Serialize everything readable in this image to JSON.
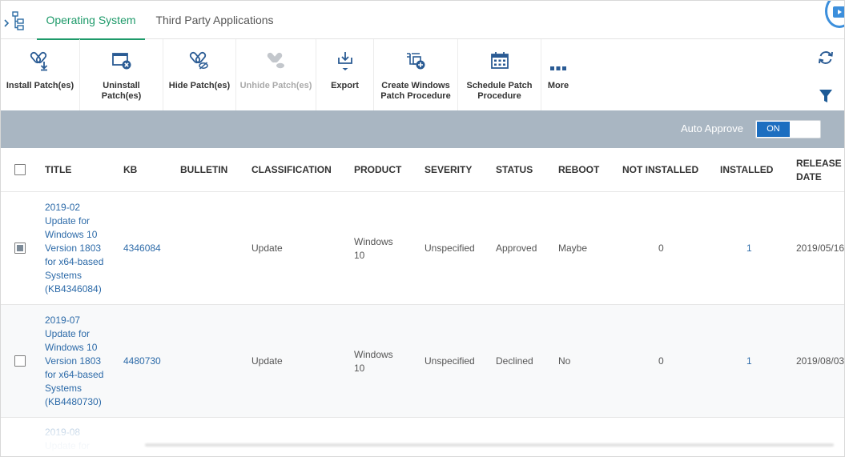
{
  "tabs": [
    {
      "label": "Operating System",
      "active": true
    },
    {
      "label": "Third Party Applications",
      "active": false
    }
  ],
  "toolbar": {
    "install": "Install Patch(es)",
    "uninstall_1": "Uninstall",
    "uninstall_2": "Patch(es)",
    "hide": "Hide Patch(es)",
    "unhide": "Unhide Patch(es)",
    "export": "Export",
    "create_1": "Create Windows",
    "create_2": "Patch Procedure",
    "schedule_1": "Schedule Patch",
    "schedule_2": "Procedure",
    "more": "More"
  },
  "auto_approve": {
    "label": "Auto Approve",
    "state": "ON"
  },
  "table": {
    "headers": {
      "title": "TITLE",
      "kb": "KB",
      "bulletin": "BULLETIN",
      "classification": "CLASSIFICATION",
      "product": "PRODUCT",
      "severity": "SEVERITY",
      "status": "STATUS",
      "reboot": "REBOOT",
      "not_installed": "NOT INSTALLED",
      "installed": "INSTALLED",
      "release_1": "RELEASE",
      "release_2": "DATE"
    },
    "rows": [
      {
        "checked": true,
        "title_lines": [
          "2019-02",
          "Update for",
          "Windows 10",
          "Version 1803",
          "for x64-based",
          "Systems",
          "(KB4346084)"
        ],
        "kb": "4346084",
        "bulletin": "",
        "classification": "Update",
        "product_1": "Windows",
        "product_2": "10",
        "severity": "Unspecified",
        "status": "Approved",
        "reboot": "Maybe",
        "not_installed": "0",
        "installed": "1",
        "release_date": "2019/05/16"
      },
      {
        "checked": false,
        "title_lines": [
          "2019-07",
          "Update for",
          "Windows 10",
          "Version 1803",
          "for x64-based",
          "Systems",
          "(KB4480730)"
        ],
        "kb": "4480730",
        "bulletin": "",
        "classification": "Update",
        "product_1": "Windows",
        "product_2": "10",
        "severity": "Unspecified",
        "status": "Declined",
        "reboot": "No",
        "not_installed": "0",
        "installed": "1",
        "release_date": "2019/08/03"
      },
      {
        "checked": false,
        "title_lines": [
          "2019-08",
          "Update for"
        ]
      }
    ]
  },
  "colors": {
    "accent_green": "#1e9a6a",
    "link_blue": "#2c6aa8",
    "toggle_blue": "#1c6ec0",
    "bar_gray": "#a9b6c2"
  },
  "icons": {
    "tree": "tree-view-icon",
    "refresh": "refresh-icon",
    "filter": "filter-icon"
  }
}
